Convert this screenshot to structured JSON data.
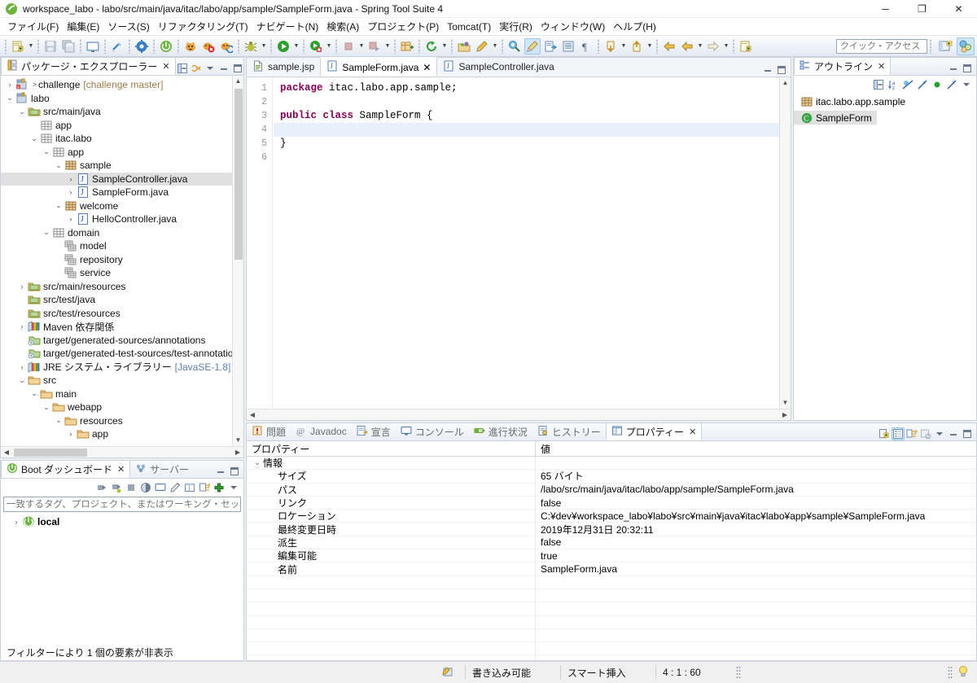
{
  "window": {
    "title": "workspace_labo - labo/src/main/java/itac/labo/app/sample/SampleForm.java - Spring Tool Suite 4",
    "minimize": "─",
    "maximize": "❐",
    "close": "✕"
  },
  "menubar": {
    "items": [
      "ファイル(F)",
      "編集(E)",
      "ソース(S)",
      "リファクタリング(T)",
      "ナビゲート(N)",
      "検索(A)",
      "プロジェクト(P)",
      "Tomcat(T)",
      "実行(R)",
      "ウィンドウ(W)",
      "ヘルプ(H)"
    ]
  },
  "toolbar": {
    "quick_access_placeholder": "クイック・アクセス",
    "icons": [
      "new-wizard-icon",
      "save-icon",
      "save-all-icon",
      "open-console-icon",
      "toggle-breadcrumb-icon",
      "build-icon",
      "boot-run-icon",
      "tomcat-start-icon",
      "tomcat-stop-icon",
      "tomcat-restart-icon",
      "debug-icon",
      "run-icon",
      "run-as-server-icon",
      "terminate-icon",
      "relaunch-icon",
      "new-java-package-icon",
      "refresh-icon",
      "open-type-icon",
      "search-icon",
      "external-tools-icon",
      "pin-editor-icon",
      "toggle-mark-occurrences-icon",
      "open-task-icon",
      "show-whitespace-icon",
      "pilcrow-icon",
      "next-annotation-icon",
      "previous-annotation-icon",
      "back-icon",
      "last-edit-icon",
      "forward-icon",
      "new-editor-icon"
    ],
    "perspective_buttons": [
      "open-perspective-icon",
      "spring-perspective-icon"
    ]
  },
  "package_explorer": {
    "tab_label": "パッケージ・エクスプローラー",
    "toolbar_icons": [
      "collapse-all-icon",
      "link-with-editor-icon",
      "view-menu-icon",
      "minimize-icon",
      "maximize-icon"
    ],
    "tree": [
      {
        "indent": 0,
        "twisty": "collapsed",
        "icon": "project-git-icon",
        "label": "challenge",
        "decoration": "[challenge master]",
        "prefix": ">"
      },
      {
        "indent": 0,
        "twisty": "expanded",
        "icon": "project-icon",
        "label": "labo",
        "decoration": ""
      },
      {
        "indent": 1,
        "twisty": "expanded",
        "icon": "source-folder-icon",
        "label": "src/main/java",
        "decoration": ""
      },
      {
        "indent": 2,
        "twisty": "none",
        "icon": "package-empty-icon",
        "label": "app",
        "decoration": ""
      },
      {
        "indent": 2,
        "twisty": "expanded",
        "icon": "package-empty-icon",
        "label": "itac.labo",
        "decoration": ""
      },
      {
        "indent": 3,
        "twisty": "expanded",
        "icon": "package-empty-icon",
        "label": "app",
        "decoration": ""
      },
      {
        "indent": 4,
        "twisty": "expanded",
        "icon": "package-icon",
        "label": "sample",
        "decoration": ""
      },
      {
        "indent": 5,
        "twisty": "collapsed",
        "icon": "java-file-icon",
        "label": "SampleController.java",
        "decoration": "",
        "selected": true
      },
      {
        "indent": 5,
        "twisty": "collapsed",
        "icon": "java-file-icon",
        "label": "SampleForm.java",
        "decoration": ""
      },
      {
        "indent": 4,
        "twisty": "expanded",
        "icon": "package-icon",
        "label": "welcome",
        "decoration": ""
      },
      {
        "indent": 5,
        "twisty": "collapsed",
        "icon": "java-file-icon",
        "label": "HelloController.java",
        "decoration": ""
      },
      {
        "indent": 3,
        "twisty": "expanded",
        "icon": "package-empty-icon",
        "label": "domain",
        "decoration": ""
      },
      {
        "indent": 4,
        "twisty": "none",
        "icon": "package-frag-icon",
        "label": "model",
        "decoration": ""
      },
      {
        "indent": 4,
        "twisty": "none",
        "icon": "package-frag-icon",
        "label": "repository",
        "decoration": ""
      },
      {
        "indent": 4,
        "twisty": "none",
        "icon": "package-frag-icon",
        "label": "service",
        "decoration": ""
      },
      {
        "indent": 1,
        "twisty": "collapsed",
        "icon": "source-folder-icon",
        "label": "src/main/resources",
        "decoration": ""
      },
      {
        "indent": 1,
        "twisty": "none",
        "icon": "source-folder-icon",
        "label": "src/test/java",
        "decoration": ""
      },
      {
        "indent": 1,
        "twisty": "none",
        "icon": "source-folder-icon",
        "label": "src/test/resources",
        "decoration": ""
      },
      {
        "indent": 1,
        "twisty": "collapsed",
        "icon": "library-icon",
        "label": "Maven 依存関係",
        "decoration": ""
      },
      {
        "indent": 1,
        "twisty": "none",
        "icon": "generated-source-icon",
        "label": "target/generated-sources/annotations",
        "decoration": ""
      },
      {
        "indent": 1,
        "twisty": "none",
        "icon": "generated-source-icon",
        "label": "target/generated-test-sources/test-annotations",
        "decoration": ""
      },
      {
        "indent": 1,
        "twisty": "collapsed",
        "icon": "library-icon",
        "label": "JRE システム・ライブラリー",
        "decoration": "[JavaSE-1.8]"
      },
      {
        "indent": 1,
        "twisty": "expanded",
        "icon": "folder-icon",
        "label": "src",
        "decoration": ""
      },
      {
        "indent": 2,
        "twisty": "expanded",
        "icon": "folder-icon",
        "label": "main",
        "decoration": ""
      },
      {
        "indent": 3,
        "twisty": "expanded",
        "icon": "folder-icon",
        "label": "webapp",
        "decoration": ""
      },
      {
        "indent": 4,
        "twisty": "expanded",
        "icon": "folder-icon",
        "label": "resources",
        "decoration": ""
      },
      {
        "indent": 5,
        "twisty": "collapsed",
        "icon": "folder-icon",
        "label": "app",
        "decoration": ""
      }
    ]
  },
  "boot_dashboard": {
    "tabs": [
      {
        "label": "Boot ダッシュボード",
        "icon": "boot-icon",
        "selected": true,
        "closeable": true
      },
      {
        "label": "サーバー",
        "icon": "servers-icon",
        "selected": false,
        "closeable": false
      }
    ],
    "toolbar_icons": [
      "start-icon",
      "debug-start-icon",
      "stop-icon",
      "open-browser-icon",
      "open-console-icon",
      "edit-icon",
      "properties-icon",
      "toggle-filters-icon",
      "add-icon",
      "view-menu-icon"
    ],
    "filter_placeholder": "一致するタグ、プロジェクト、またはワーキング・セット名を入力します",
    "items": [
      {
        "twisty": "collapsed",
        "icon": "boot-local-icon",
        "label": "local"
      }
    ],
    "status_message": "フィルターにより 1 個の要素が非表示"
  },
  "editor": {
    "tabs": [
      {
        "label": "sample.jsp",
        "icon": "jsp-file-icon",
        "selected": false
      },
      {
        "label": "SampleForm.java",
        "icon": "java-file-icon",
        "selected": true
      },
      {
        "label": "SampleController.java",
        "icon": "java-file-icon",
        "selected": false
      }
    ],
    "line_numbers": [
      "1",
      "2",
      "3",
      "4",
      "5",
      "6"
    ],
    "lines": [
      {
        "n": 1,
        "tokens": [
          {
            "t": "package",
            "k": true
          },
          {
            "t": " itac.labo.app.sample;",
            "k": false
          }
        ],
        "current": false
      },
      {
        "n": 2,
        "tokens": [
          {
            "t": "",
            "k": false
          }
        ],
        "current": false
      },
      {
        "n": 3,
        "tokens": [
          {
            "t": "public class",
            "k": true
          },
          {
            "t": " SampleForm {",
            "k": false
          }
        ],
        "current": false
      },
      {
        "n": 4,
        "tokens": [
          {
            "t": "",
            "k": false
          }
        ],
        "current": true
      },
      {
        "n": 5,
        "tokens": [
          {
            "t": "}",
            "k": false
          }
        ],
        "current": false
      },
      {
        "n": 6,
        "tokens": [
          {
            "t": "",
            "k": false
          }
        ],
        "current": false
      }
    ],
    "keyword_color": "#7f0055",
    "current_line_color": "#e8f0fb"
  },
  "outline": {
    "tab_label": "アウトライン",
    "toolbar_icons": [
      "collapse-all-icon",
      "sort-icon",
      "hide-fields-icon",
      "hide-static-icon",
      "hide-nonpublic-icon",
      "hide-local-types-icon",
      "view-menu-icon"
    ],
    "items": [
      {
        "indent": 0,
        "icon": "package-icon",
        "label": "itac.labo.app.sample",
        "selected": false
      },
      {
        "indent": 0,
        "icon": "class-icon",
        "label": "SampleForm",
        "selected": true
      }
    ]
  },
  "bottom_panel": {
    "tabs": [
      {
        "label": "問題",
        "icon": "problems-icon",
        "selected": false
      },
      {
        "label": "Javadoc",
        "icon": "javadoc-icon",
        "selected": false
      },
      {
        "label": "宣言",
        "icon": "declaration-icon",
        "selected": false
      },
      {
        "label": "コンソール",
        "icon": "console-icon",
        "selected": false
      },
      {
        "label": "進行状況",
        "icon": "progress-icon",
        "selected": false
      },
      {
        "label": "ヒストリー",
        "icon": "history-icon",
        "selected": false
      },
      {
        "label": "プロパティー",
        "icon": "properties-icon",
        "selected": true
      }
    ],
    "toolbar_icons": [
      "new-icon",
      "show-categories-icon",
      "show-advanced-icon",
      "restore-default-icon",
      "view-menu-icon",
      "minimize-icon",
      "maximize-icon"
    ],
    "table": {
      "columns": [
        "プロパティー",
        "値"
      ],
      "rows": [
        {
          "type": "group",
          "twisty": "expanded",
          "name": "情報",
          "value": ""
        },
        {
          "type": "item",
          "name": "サイズ",
          "value": "65 バイト"
        },
        {
          "type": "item",
          "name": "パス",
          "value": "/labo/src/main/java/itac/labo/app/sample/SampleForm.java"
        },
        {
          "type": "item",
          "name": "リンク",
          "value": "false"
        },
        {
          "type": "item",
          "name": "ロケーション",
          "value": "C:¥dev¥workspace_labo¥labo¥src¥main¥java¥itac¥labo¥app¥sample¥SampleForm.java"
        },
        {
          "type": "item",
          "name": "最終変更日時",
          "value": "2019年12月31日 20:32:11"
        },
        {
          "type": "item",
          "name": "派生",
          "value": "false"
        },
        {
          "type": "item",
          "name": "編集可能",
          "value": "true"
        },
        {
          "type": "item",
          "name": "名前",
          "value": "SampleForm.java"
        }
      ]
    }
  },
  "statusbar": {
    "icon": "writable-mode-icon",
    "writable": "書き込み可能",
    "insert_mode": "スマート挿入",
    "position": "4 : 1 : 60",
    "tip_icon": "smart-tip-icon"
  }
}
